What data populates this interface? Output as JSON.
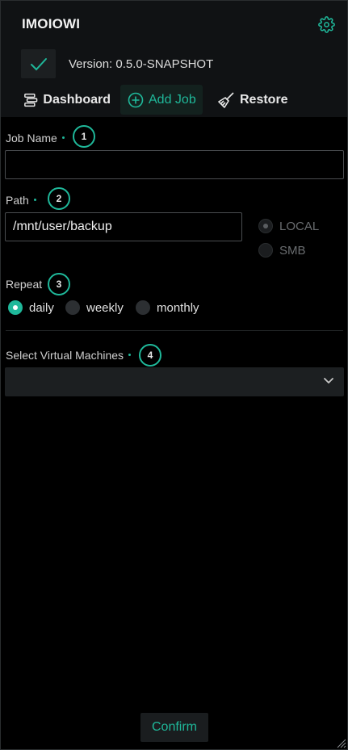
{
  "app": {
    "title": "IMOIOWI",
    "version": "Version: 0.5.0-SNAPSHOT"
  },
  "icons": {
    "settings": "gear-icon",
    "status": "check-icon",
    "dashboard": "dashboard-icon",
    "add_job": "plus-circle-icon",
    "restore": "broom-icon",
    "select": "chevron-down-icon",
    "resize": "resize-handle-icon"
  },
  "colors": {
    "accent": "#1fb89a",
    "background": "#000000",
    "header": "#101214"
  },
  "nav": {
    "dashboard": "Dashboard",
    "add_job": "Add Job",
    "restore": "Restore",
    "active": "Add Job"
  },
  "form": {
    "job_name": {
      "label": "Job Name",
      "step": "1",
      "value": ""
    },
    "path": {
      "label": "Path",
      "step": "2",
      "value": "/mnt/user/backup",
      "options": [
        "LOCAL",
        "SMB"
      ],
      "selected": "LOCAL",
      "disabled": true
    },
    "repeat": {
      "label": "Repeat",
      "step": "3",
      "options": [
        "daily",
        "weekly",
        "monthly"
      ],
      "selected": "daily"
    },
    "vms": {
      "label": "Select Virtual Machines",
      "step": "4",
      "value": ""
    }
  },
  "confirm_label": "Confirm"
}
